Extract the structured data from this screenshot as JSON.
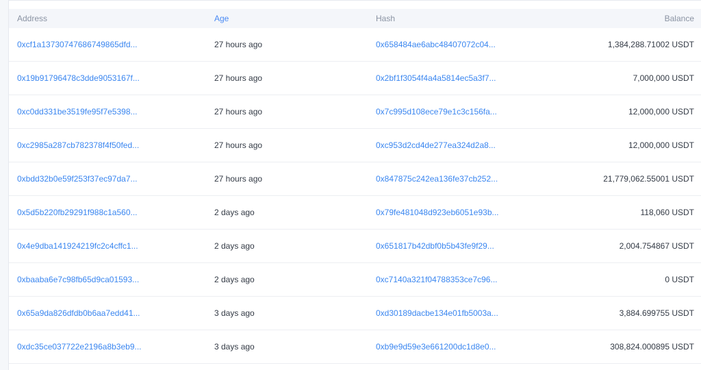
{
  "table": {
    "columns": {
      "address": "Address",
      "age": "Age",
      "hash": "Hash",
      "balance": "Balance"
    },
    "rows": [
      {
        "address": "0xcf1a13730747686749865dfd...",
        "age": "27 hours ago",
        "hash": "0x658484ae6abc48407072c04...",
        "balance": "1,384,288.71002 USDT"
      },
      {
        "address": "0x19b91796478c3dde9053167f...",
        "age": "27 hours ago",
        "hash": "0x2bf1f3054f4a4a5814ec5a3f7...",
        "balance": "7,000,000 USDT"
      },
      {
        "address": "0xc0dd331be3519fe95f7e5398...",
        "age": "27 hours ago",
        "hash": "0x7c995d108ece79e1c3c156fa...",
        "balance": "12,000,000 USDT"
      },
      {
        "address": "0xc2985a287cb782378f4f50fed...",
        "age": "27 hours ago",
        "hash": "0xc953d2cd4de277ea324d2a8...",
        "balance": "12,000,000 USDT"
      },
      {
        "address": "0xbdd32b0e59f253f37ec97da7...",
        "age": "27 hours ago",
        "hash": "0x847875c242ea136fe37cb252...",
        "balance": "21,779,062.55001 USDT"
      },
      {
        "address": "0x5d5b220fb29291f988c1a560...",
        "age": "2 days ago",
        "hash": "0x79fe481048d923eb6051e93b...",
        "balance": "118,060 USDT"
      },
      {
        "address": "0x4e9dba141924219fc2c4cffc1...",
        "age": "2 days ago",
        "hash": "0x651817b42dbf0b5b43fe9f29...",
        "balance": "2,004.754867 USDT"
      },
      {
        "address": "0xbaaba6e7c98fb65d9ca01593...",
        "age": "2 days ago",
        "hash": "0xc7140a321f04788353ce7c96...",
        "balance": "0 USDT"
      },
      {
        "address": "0x65a9da826dfdb0b6aa7edd41...",
        "age": "3 days ago",
        "hash": "0xd30189dacbe134e01fb5003a...",
        "balance": "3,884.699755 USDT"
      },
      {
        "address": "0xdc35ce037722e2196a8b3eb9...",
        "age": "3 days ago",
        "hash": "0xb9e9d59e3e661200dc1d8e0...",
        "balance": "308,824.000895 USDT"
      }
    ]
  },
  "colors": {
    "link": "#3a86f0",
    "header_bg": "#f4f6fa",
    "header_text": "#8a93a3",
    "active_header": "#4a8af4",
    "body_text": "#333a45"
  }
}
